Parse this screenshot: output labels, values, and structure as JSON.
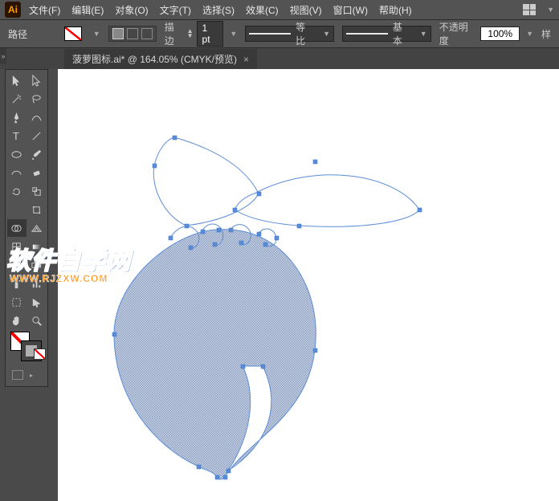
{
  "app_icon_label": "Ai",
  "menu": {
    "file": "文件(F)",
    "edit": "编辑(E)",
    "object": "对象(O)",
    "type": "文字(T)",
    "select": "选择(S)",
    "effect": "效果(C)",
    "view": "视图(V)",
    "window": "窗口(W)",
    "help": "帮助(H)"
  },
  "controlbar": {
    "path_label": "路径",
    "stroke_label": "描边",
    "stroke_value": "1 pt",
    "profile_label": "等比",
    "brush_label": "基本",
    "opacity_label": "不透明度",
    "opacity_value": "100%",
    "style_label": "样"
  },
  "tab": {
    "filename": "菠萝图标.ai*",
    "zoom": "164.05%",
    "mode": "CMYK/预览"
  },
  "watermark": {
    "main": "软件自学网",
    "sub": "WWW.RJZXW.COM"
  },
  "tools": {
    "selection": "selection-tool",
    "direct": "direct-selection-tool",
    "wand": "magic-wand-tool",
    "lasso": "lasso-tool",
    "pen": "pen-tool",
    "curvature": "curvature-tool",
    "type": "type-tool",
    "line": "line-segment-tool",
    "ellipse": "ellipse-tool",
    "brush": "paintbrush-tool",
    "shaper": "shaper-tool",
    "eraser": "eraser-tool",
    "rotate": "rotate-tool",
    "scale": "scale-tool",
    "width": "width-tool",
    "free": "free-transform-tool",
    "shapebuilder": "shape-builder-tool",
    "perspective": "perspective-grid-tool",
    "mesh": "mesh-tool",
    "gradient": "gradient-tool",
    "eyedrop": "eyedropper-tool",
    "blend": "blend-tool",
    "symbol": "symbol-sprayer-tool",
    "graph": "column-graph-tool",
    "artboard": "artboard-tool",
    "slice": "slice-tool",
    "hand": "hand-tool",
    "zoom": "zoom-tool"
  }
}
